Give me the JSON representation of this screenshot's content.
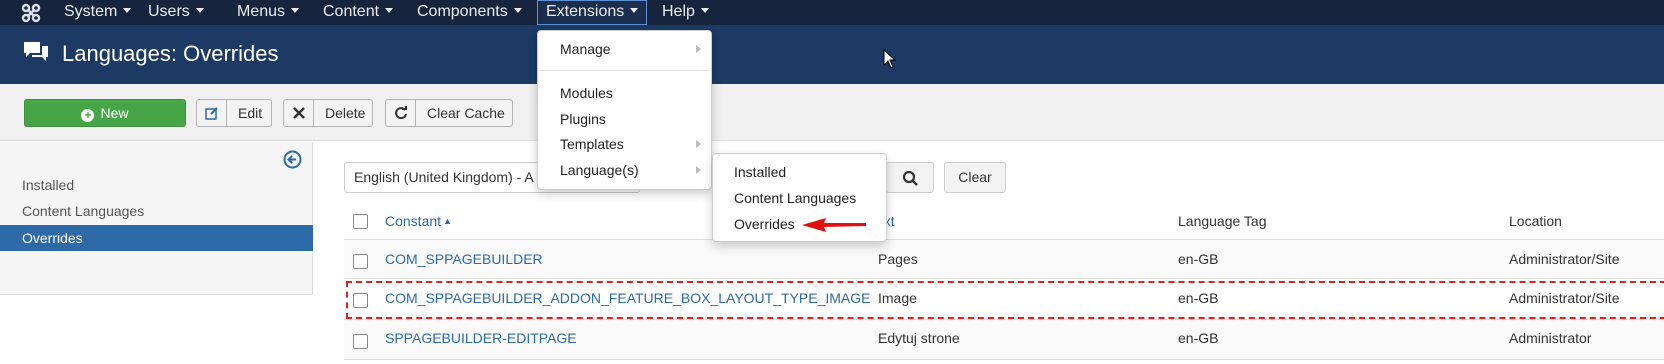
{
  "navbar": {
    "items": [
      {
        "label": "System"
      },
      {
        "label": "Users"
      },
      {
        "label": "Menus"
      },
      {
        "label": "Content"
      },
      {
        "label": "Components"
      },
      {
        "label": "Extensions"
      },
      {
        "label": "Help"
      }
    ],
    "active": "Extensions",
    "logo_icon": "joomla-logo-icon"
  },
  "header": {
    "title": "Languages: Overrides",
    "icon": "comments-icon"
  },
  "toolbar": {
    "new_label": "New",
    "edit_label": "Edit",
    "delete_label": "Delete",
    "clear_cache_label": "Clear Cache"
  },
  "sidebar": {
    "items": [
      {
        "label": "Installed"
      },
      {
        "label": "Content Languages"
      },
      {
        "label": "Overrides",
        "active": true
      }
    ]
  },
  "filter": {
    "language_select": "English (United Kingdom) - A",
    "clear_label": "Clear"
  },
  "table": {
    "headers": {
      "constant": "Constant",
      "text": "ext",
      "language_tag": "Language Tag",
      "location": "Location"
    },
    "rows": [
      {
        "constant": "COM_SPPAGEBUILDER",
        "text": "Pages",
        "tag": "en-GB",
        "location": "Administrator/Site"
      },
      {
        "constant": "COM_SPPAGEBUILDER_ADDON_FEATURE_BOX_LAYOUT_TYPE_IMAGE",
        "text": "Image",
        "tag": "en-GB",
        "location": "Administrator/Site"
      },
      {
        "constant": "SPPAGEBUILDER-EDITPAGE",
        "text": "Edytuj strone",
        "tag": "en-GB",
        "location": "Administrator"
      }
    ]
  },
  "extensions_menu": {
    "items": [
      {
        "label": "Manage"
      },
      {
        "label": "Modules"
      },
      {
        "label": "Plugins"
      },
      {
        "label": "Templates"
      },
      {
        "label": "Language(s)"
      }
    ]
  },
  "languages_submenu": {
    "items": [
      {
        "label": "Installed"
      },
      {
        "label": "Content Languages"
      },
      {
        "label": "Overrides"
      }
    ]
  },
  "colors": {
    "navbar": "#16243d",
    "header": "#1c3a63",
    "accent": "#2e69a8",
    "new_button": "#46a546",
    "highlight": "#e02020"
  }
}
